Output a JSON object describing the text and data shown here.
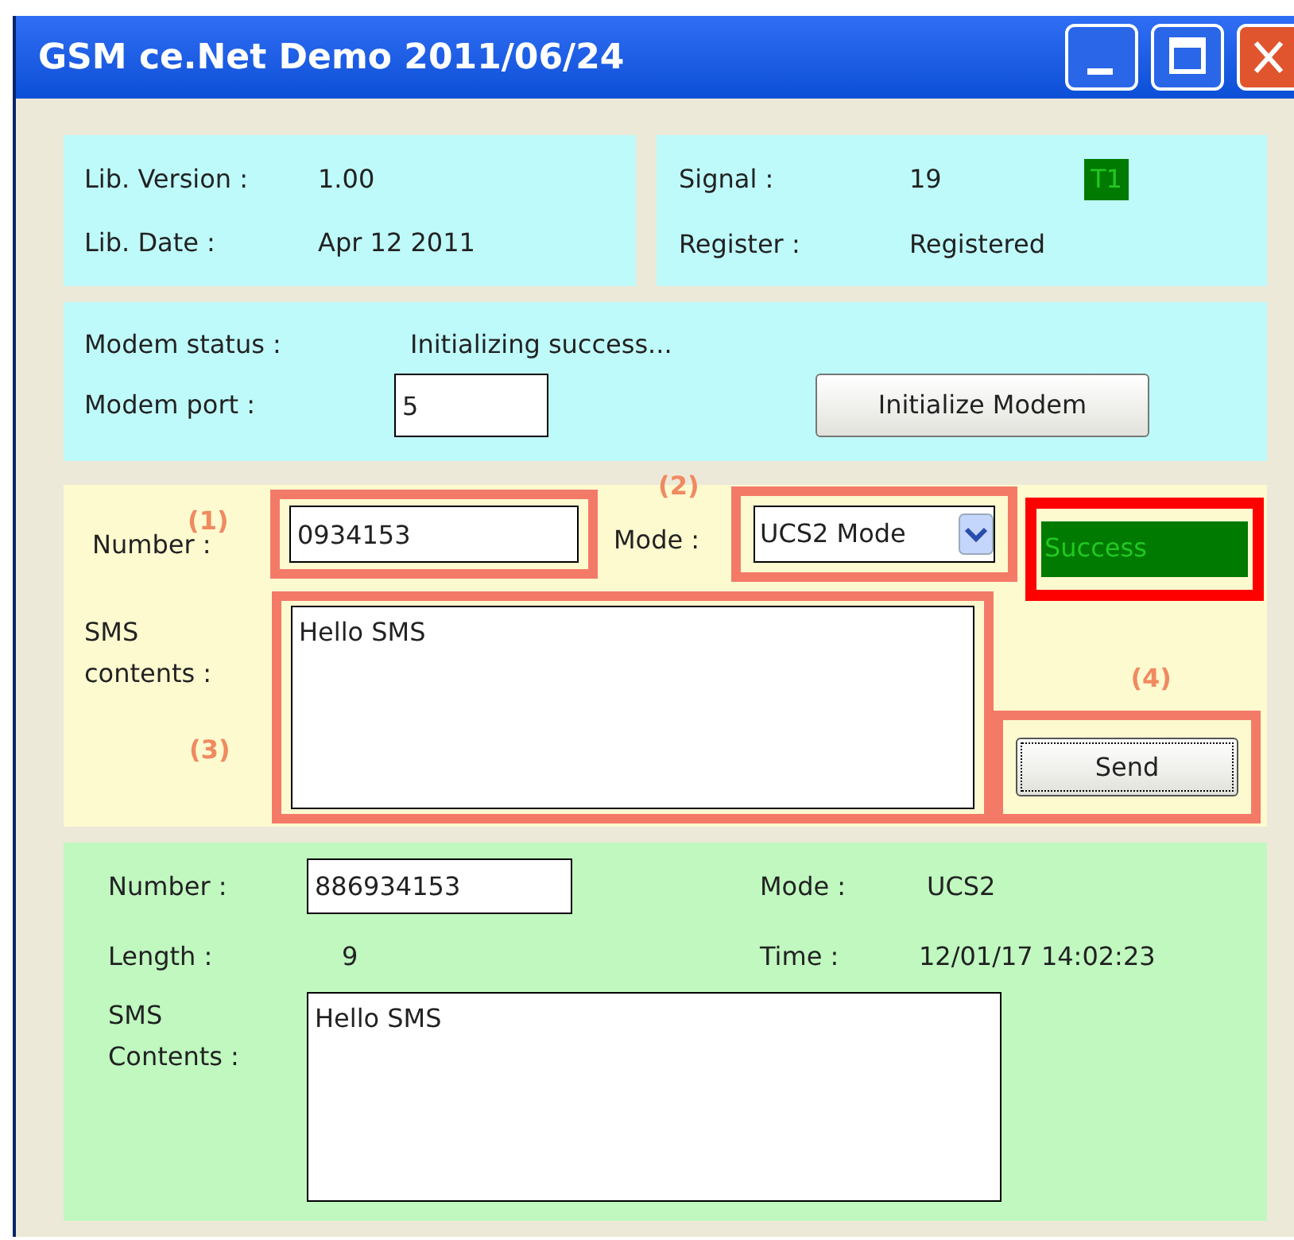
{
  "window": {
    "title": "GSM ce.Net Demo 2011/06/24"
  },
  "info": {
    "left": [
      {
        "label": "Lib. Version :",
        "value": "1.00"
      },
      {
        "label": "Lib. Date :",
        "value": "Apr 12 2011"
      }
    ],
    "right": [
      {
        "label": "Signal :",
        "value": "19",
        "badge": "T1"
      },
      {
        "label": "Register :",
        "value": "Registered"
      }
    ]
  },
  "modem": {
    "status_label": "Modem status :",
    "status": "Initializing success...",
    "port_label": "Modem port :",
    "port": "5",
    "button": "Initialize Modem"
  },
  "send": {
    "number_label": "Number :",
    "number": "0934153",
    "mode_label": "Mode :",
    "mode": "UCS2 Mode",
    "result": "Success",
    "contents_label": "SMS contents :",
    "contents": "Hello SMS",
    "button": "Send"
  },
  "annotations": [
    "(1)",
    "(2)",
    "(3)",
    "(4)"
  ],
  "received": {
    "number_label": "Number :",
    "number": "886934153",
    "mode_label": "Mode :",
    "mode": "UCS2",
    "length_label": "Length :",
    "length": "9",
    "time_label": "Time :",
    "time": "12/01/17 14:02:23",
    "contents_label": "SMS Contents :",
    "contents": "Hello SMS"
  }
}
